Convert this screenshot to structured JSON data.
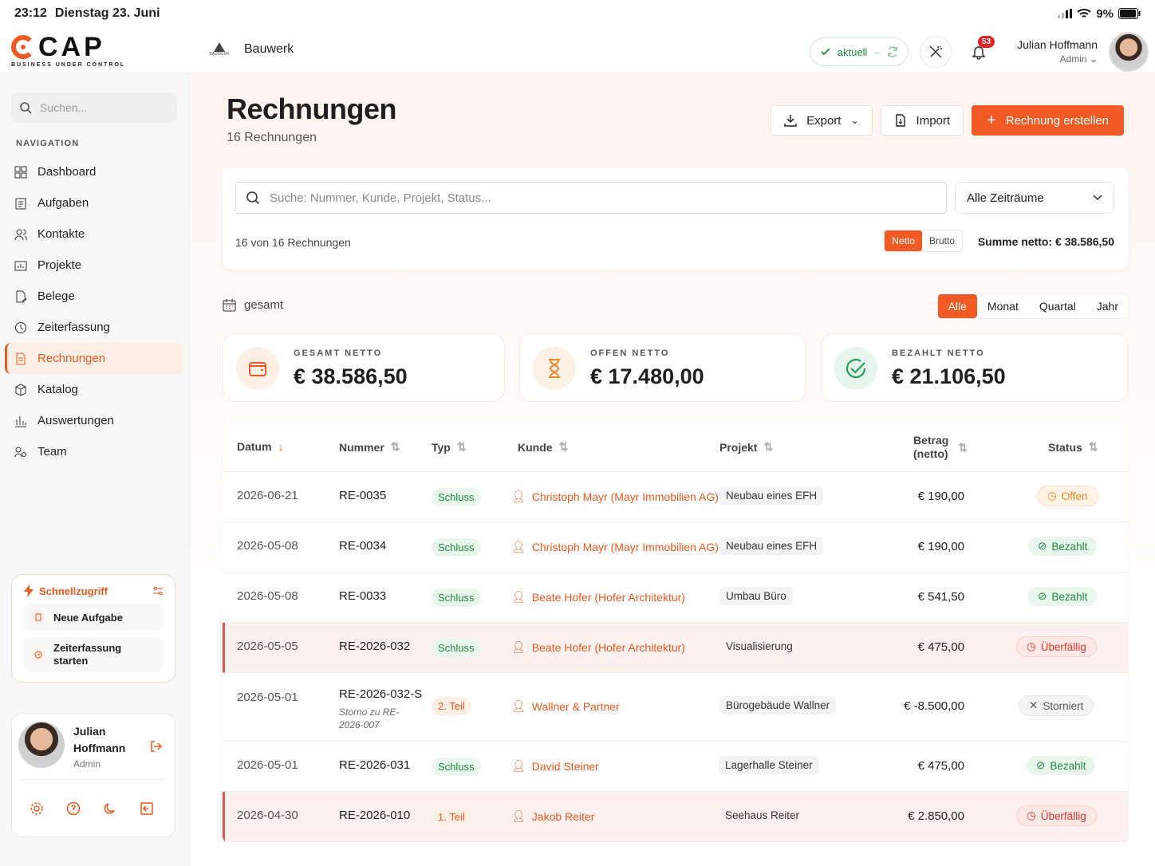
{
  "status_bar": {
    "time": "23:12",
    "date": "Dienstag 23. Juni",
    "battery": "9%"
  },
  "brand": {
    "name": "CAP",
    "tagline": "BUSINESS UNDER CONTROL"
  },
  "project": {
    "logo_text": "BAUWERK",
    "name": "Bauwerk"
  },
  "topbar": {
    "sync_label": "aktuell",
    "sync_sep": "--",
    "notifications": "53",
    "user_name": "Julian Hoffmann",
    "user_role": "Admin"
  },
  "sidebar": {
    "search_placeholder": "Suchen...",
    "nav_label": "NAVIGATION",
    "items": [
      {
        "label": "Dashboard",
        "icon": "grid-icon"
      },
      {
        "label": "Aufgaben",
        "icon": "clipboard-icon"
      },
      {
        "label": "Kontakte",
        "icon": "users-icon"
      },
      {
        "label": "Projekte",
        "icon": "folder-chart-icon"
      },
      {
        "label": "Belege",
        "icon": "receipt-edit-icon"
      },
      {
        "label": "Zeiterfassung",
        "icon": "clock-icon"
      },
      {
        "label": "Rechnungen",
        "icon": "invoice-icon",
        "active": true
      },
      {
        "label": "Katalog",
        "icon": "box-icon"
      },
      {
        "label": "Auswertungen",
        "icon": "bar-chart-icon"
      },
      {
        "label": "Team",
        "icon": "team-icon"
      }
    ],
    "quick_access": {
      "title": "Schnellzugriff",
      "items": [
        {
          "label": "Neue Aufgabe"
        },
        {
          "label": "Zeiterfassung starten"
        }
      ]
    },
    "profile": {
      "name": "Julian Hoffmann",
      "role": "Admin"
    }
  },
  "page": {
    "title": "Rechnungen",
    "subtitle": "16 Rechnungen",
    "export_label": "Export",
    "import_label": "Import",
    "create_label": "Rechnung erstellen"
  },
  "filters": {
    "search_placeholder": "Suche: Nummer, Kunde, Projekt, Status...",
    "period_select": "Alle Zeiträume",
    "count_text": "16 von 16 Rechnungen",
    "netto_label": "Netto",
    "brutto_label": "Brutto",
    "sum_text": "Summe netto: € 38.586,50"
  },
  "period": {
    "label": "gesamt",
    "tabs": [
      "Alle",
      "Monat",
      "Quartal",
      "Jahr"
    ],
    "active": "Alle"
  },
  "kpis": [
    {
      "label": "GESAMT NETTO",
      "value": "€ 38.586,50",
      "icon": "wallet-icon",
      "color": "#f15a24"
    },
    {
      "label": "OFFEN NETTO",
      "value": "€ 17.480,00",
      "icon": "hourglass-icon",
      "color": "#f1892b"
    },
    {
      "label": "BEZAHLT NETTO",
      "value": "€ 21.106,50",
      "icon": "check-circle-icon",
      "color": "#23a455"
    }
  ],
  "table": {
    "headers": {
      "datum": "Datum",
      "nummer": "Nummer",
      "typ": "Typ",
      "kunde": "Kunde",
      "projekt": "Projekt",
      "betrag_1": "Betrag",
      "betrag_2": "(netto)",
      "status": "Status"
    },
    "rows": [
      {
        "datum": "2026-06-21",
        "nummer": "RE-0035",
        "typ": "Schluss",
        "kunde": "Christoph Mayr (Mayr Immobilien AG)",
        "projekt": "Neubau eines EFH",
        "betrag": "€ 190,00",
        "status": "Offen"
      },
      {
        "datum": "2026-05-08",
        "nummer": "RE-0034",
        "typ": "Schluss",
        "kunde": "Christoph Mayr (Mayr Immobilien AG)",
        "projekt": "Neubau eines EFH",
        "betrag": "€ 190,00",
        "status": "Bezahlt"
      },
      {
        "datum": "2026-05-08",
        "nummer": "RE-0033",
        "typ": "Schluss",
        "kunde": "Beate Hofer (Hofer Architektur)",
        "projekt": "Umbau Büro",
        "betrag": "€ 541,50",
        "status": "Bezahlt"
      },
      {
        "datum": "2026-05-05",
        "nummer": "RE-2026-032",
        "typ": "Schluss",
        "kunde": "Beate Hofer (Hofer Architektur)",
        "projekt": "Visualisierung",
        "betrag": "€ 475,00",
        "status": "Überfällig"
      },
      {
        "datum": "2026-05-01",
        "nummer": "RE-2026-032-S",
        "note": "Storno zu RE-2026-007",
        "typ": "2. Teil",
        "kunde": "Wallner & Partner",
        "projekt": "Bürogebäude Wallner",
        "betrag": "€ -8.500,00",
        "status": "Storniert"
      },
      {
        "datum": "2026-05-01",
        "nummer": "RE-2026-031",
        "typ": "Schluss",
        "kunde": "David Steiner",
        "projekt": "Lagerhalle Steiner",
        "betrag": "€ 475,00",
        "status": "Bezahlt"
      },
      {
        "datum": "2026-04-30",
        "nummer": "RE-2026-010",
        "typ": "1. Teil",
        "kunde": "Jakob Reiter",
        "projekt": "Seehaus Reiter",
        "betrag": "€ 2.850,00",
        "status": "Überfällig"
      }
    ]
  }
}
